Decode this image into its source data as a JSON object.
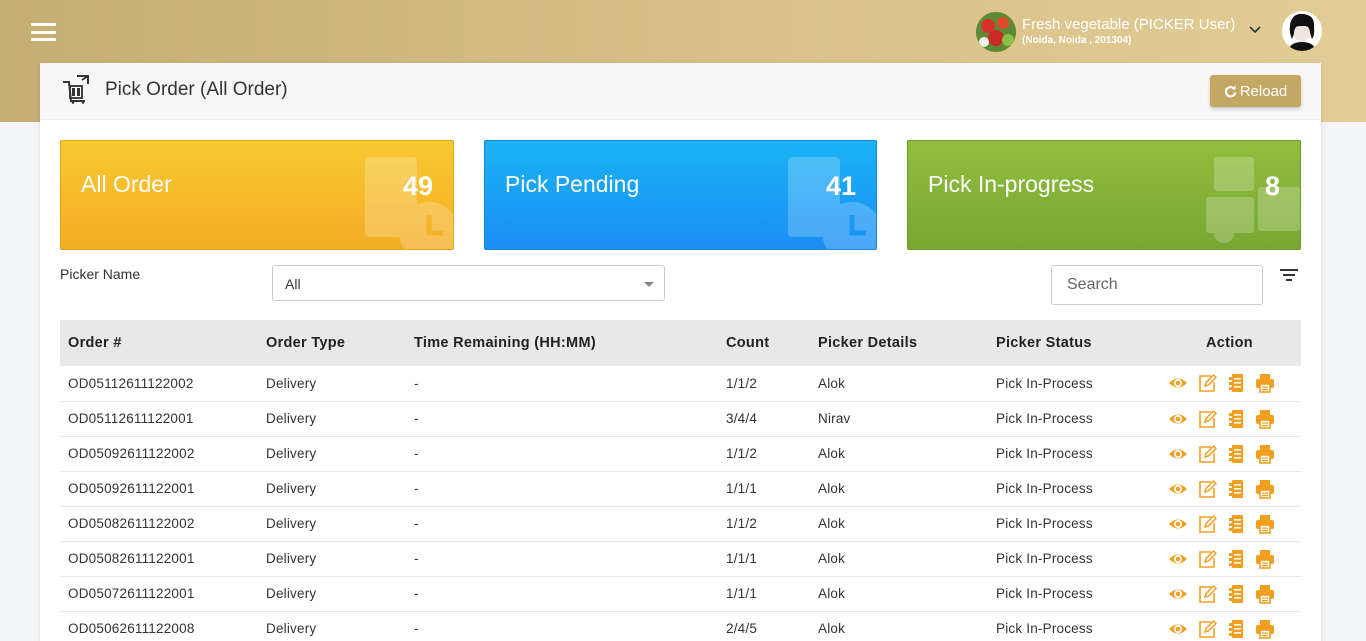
{
  "header": {
    "menu_icon": "hamburger-icon",
    "store_name": "Fresh vegetable (PICKER User)",
    "store_address": "(Noida, Noida , 201304)",
    "brand_color": "#c5ae72"
  },
  "page": {
    "title": "Pick Order (All Order)",
    "reload_label": "Reload"
  },
  "stats": {
    "all": {
      "label": "All Order",
      "count": "49",
      "color": "#f6b82a"
    },
    "pending": {
      "label": "Pick Pending",
      "count": "41",
      "color": "#1aa3f5"
    },
    "progress": {
      "label": "Pick In-progress",
      "count": "8",
      "color": "#84b339"
    }
  },
  "filters": {
    "picker_label": "Picker Name",
    "picker_value": "All",
    "search_placeholder": "Search"
  },
  "table": {
    "columns": [
      "Order #",
      "Order Type",
      "Time Remaining (HH:MM)",
      "Count",
      "Picker Details",
      "Picker Status",
      "Action"
    ],
    "action_icons": [
      "eye-icon",
      "edit-icon",
      "document-icon",
      "print-icon"
    ],
    "action_color": "#f29f20",
    "rows": [
      [
        "OD05112611122002",
        "Delivery",
        "-",
        "1/1/2",
        "Alok",
        "Pick In-Process"
      ],
      [
        "OD05112611122001",
        "Delivery",
        "-",
        "3/4/4",
        "Nirav",
        "Pick In-Process"
      ],
      [
        "OD05092611122002",
        "Delivery",
        "-",
        "1/1/2",
        "Alok",
        "Pick In-Process"
      ],
      [
        "OD05092611122001",
        "Delivery",
        "-",
        "1/1/1",
        "Alok",
        "Pick In-Process"
      ],
      [
        "OD05082611122002",
        "Delivery",
        "-",
        "1/1/2",
        "Alok",
        "Pick In-Process"
      ],
      [
        "OD05082611122001",
        "Delivery",
        "-",
        "1/1/1",
        "Alok",
        "Pick In-Process"
      ],
      [
        "OD05072611122001",
        "Delivery",
        "-",
        "1/1/1",
        "Alok",
        "Pick In-Process"
      ],
      [
        "OD05062611122008",
        "Delivery",
        "-",
        "2/4/5",
        "Alok",
        "Pick In-Process"
      ]
    ]
  }
}
